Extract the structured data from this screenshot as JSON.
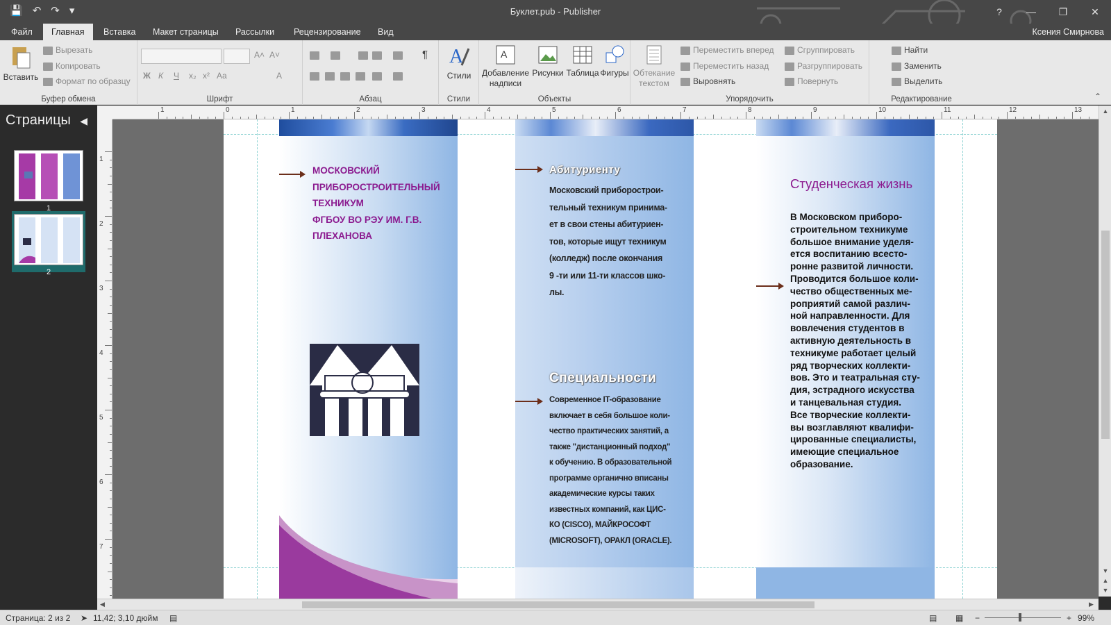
{
  "window": {
    "title": "Буклет.pub - Publisher",
    "help": "?",
    "user": "Ксения Смирнова"
  },
  "tabs": [
    "Файл",
    "Главная",
    "Вставка",
    "Макет страницы",
    "Рассылки",
    "Рецензирование",
    "Вид"
  ],
  "ribbon": {
    "clipboard": {
      "paste": "Вставить",
      "cut": "Вырезать",
      "copy": "Копировать",
      "format_painter": "Формат по образцу",
      "label": "Буфер обмена"
    },
    "font": {
      "label": "Шрифт",
      "bold": "Ж",
      "italic": "К",
      "underline": "Ч",
      "subscript": "x₂",
      "superscript": "x²",
      "case": "Aa",
      "grow": "A˄",
      "shrink": "A˅",
      "color": "A"
    },
    "paragraph": {
      "label": "Абзац",
      "pilcrow": "¶"
    },
    "styles": {
      "button": "Стили",
      "label": "Стили"
    },
    "objects": {
      "label": "Объекты",
      "textbox_line1": "Добавление",
      "textbox_line2": "надписи",
      "pictures": "Рисунки",
      "table": "Таблица",
      "shapes": "Фигуры"
    },
    "arrange": {
      "label": "Упорядочить",
      "wrap_line1": "Обтекание",
      "wrap_line2": "текстом",
      "bring_forward": "Переместить вперед",
      "send_backward": "Переместить назад",
      "align": "Выровнять",
      "group": "Сгруппировать",
      "ungroup": "Разгруппировать",
      "rotate": "Повернуть"
    },
    "editing": {
      "label": "Редактирование",
      "find": "Найти",
      "replace": "Заменить",
      "select": "Выделить"
    }
  },
  "pages_panel": {
    "title": "Страницы",
    "pages": [
      {
        "number": "1"
      },
      {
        "number": "2"
      }
    ]
  },
  "ruler": {
    "h_labels": [
      "1",
      "0",
      "1",
      "2",
      "3",
      "4",
      "5",
      "6",
      "7",
      "8",
      "9",
      "10",
      "11",
      "12",
      "13"
    ],
    "v_labels": [
      "1",
      "2",
      "3",
      "4",
      "5",
      "6",
      "7"
    ]
  },
  "document": {
    "col1_title": [
      "МОСКОВСКИЙ",
      "ПРИБОРОСТРОИТЕЛЬНЫЙ",
      "ТЕХНИКУМ",
      "ФГБОУ ВО РЭУ ИМ. Г.В.",
      "ПЛЕХАНОВА"
    ],
    "applicant_heading": "Абитуриенту",
    "applicant_lines": [
      "Московский приборострои-",
      "тельный техникум принима-",
      "ет в свои стены абитуриен-",
      "тов, которые ищут техникум",
      "(колледж) после окончания",
      "9 -ти или 11-ти классов шко-",
      "лы."
    ],
    "specialties_heading": "Специальности",
    "specialties_lines": [
      "Современное IT-образование",
      "включает в себя большое коли-",
      "чество практических занятий, а",
      "также \"дистанционный подход\"",
      "к обучению. В образовательной",
      "программе органично вписаны",
      "академические курсы таких",
      "известных компаний, как ЦИС-",
      "КО (CISCO), МАЙКРОСОФТ",
      "(MICROSOFT), ОРАКЛ (ORACLE)."
    ],
    "student_heading": "Студенческая жизнь",
    "student_lines": [
      "В Московском приборо-",
      "строительном техникуме",
      "большое внимание уделя-",
      "ется воспитанию всесто-",
      "ронне развитой личности.",
      "Проводится большое коли-",
      "чество общественных ме-",
      "роприятий самой различ-",
      "ной направленности. Для",
      "вовлечения студентов в",
      "активную деятельность в",
      "техникуме работает целый",
      "ряд творческих коллекти-",
      "вов. Это и театральная сту-",
      "дия, эстрадного искусства",
      "и танцевальная студия.",
      "Все творческие коллекти-",
      "вы возглавляют квалифи-",
      "цированные специалисты,",
      "имеющие специальное",
      "образование."
    ]
  },
  "status": {
    "page": "Страница: 2 из 2",
    "position": "11,42; 3,10 дюйм",
    "zoom": "99%",
    "zoom_minus": "−",
    "zoom_plus": "+"
  },
  "colors": {
    "accent_purple": "#8b1a8f",
    "ribbon_bg": "#e8e8e8",
    "titlebar": "#474747"
  }
}
